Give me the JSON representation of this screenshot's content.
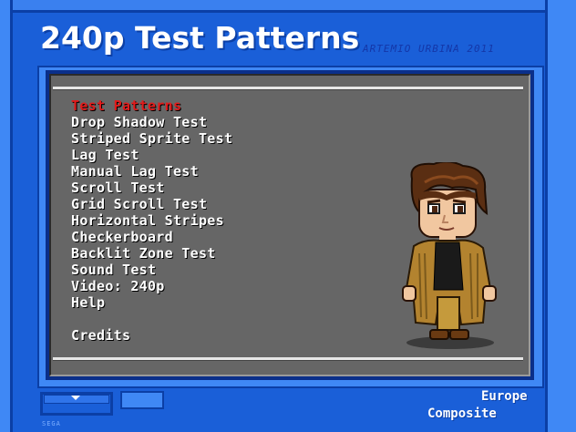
{
  "header": {
    "title": "240p Test Patterns",
    "author": "ARTEMIO URBINA 2011"
  },
  "menu": {
    "items": [
      {
        "label": "Test Patterns",
        "selected": true
      },
      {
        "label": "Drop Shadow Test",
        "selected": false
      },
      {
        "label": "Striped Sprite Test",
        "selected": false
      },
      {
        "label": "Lag Test",
        "selected": false
      },
      {
        "label": "Manual Lag Test",
        "selected": false
      },
      {
        "label": "Scroll Test",
        "selected": false
      },
      {
        "label": "Grid Scroll Test",
        "selected": false
      },
      {
        "label": "Horizontal Stripes",
        "selected": false
      },
      {
        "label": "Checkerboard",
        "selected": false
      },
      {
        "label": "Backlit Zone Test",
        "selected": false
      },
      {
        "label": "Sound Test",
        "selected": false
      },
      {
        "label": "Video: 240p",
        "selected": false
      },
      {
        "label": "Help",
        "selected": false
      },
      {
        "label": "Credits",
        "selected": false
      }
    ],
    "selected_color": "#e21b1b",
    "text_color": "#ffffff"
  },
  "status": {
    "region": "Europe",
    "signal": "Composite",
    "footer_text": "SEGA"
  },
  "colors": {
    "background": "#1a5fd8",
    "panel": "#3f88f5",
    "screen": "#666666"
  }
}
